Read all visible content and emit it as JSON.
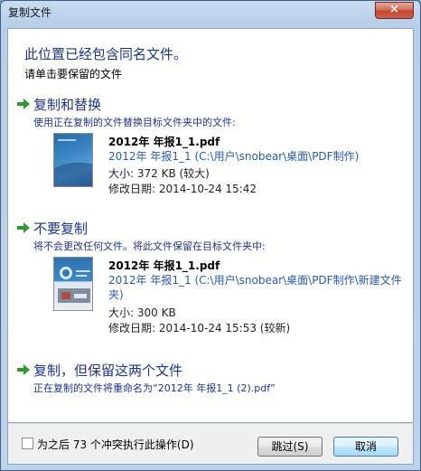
{
  "window": {
    "title": "复制文件",
    "close_label": "×"
  },
  "header": {
    "heading": "此位置已经包含同名文件。",
    "subheading": "请单击要保留的文件"
  },
  "options": {
    "replace": {
      "title": "复制和替换",
      "description": "使用正在复制的文件替换目标文件夹中的文件:",
      "file": {
        "name": "2012年 年报1_1.pdf",
        "path": "2012年 年报1_1 (C:\\用户\\snobear\\桌面\\PDF制作)",
        "size": "大小: 372 KB (较大)",
        "modified": "修改日期: 2014-10-24 15:42"
      }
    },
    "skip": {
      "title": "不要复制",
      "description": "将不会更改任何文件。将此文件保留在目标文件夹中:",
      "file": {
        "name": "2012年 年报1_1.pdf",
        "path": "2012年 年报1_1 (C:\\用户\\snobear\\桌面\\PDF制作\\新建文件夹)",
        "size": "大小: 300 KB",
        "modified": "修改日期: 2014-10-24 15:53 (较新)"
      }
    },
    "keep_both": {
      "title": "复制，但保留这两个文件",
      "description": "正在复制的文件将重命名为“2012年 年报1_1 (2).pdf”"
    }
  },
  "footer": {
    "checkbox_label": "为之后 73 个冲突执行此操作(D)",
    "checkbox_checked": false,
    "skip_button": "跳过(S)",
    "cancel_button": "取消"
  },
  "colors": {
    "link_blue": "#1e3287",
    "path_blue": "#2a5aa8",
    "arrow_green": "#2f9a2c"
  }
}
